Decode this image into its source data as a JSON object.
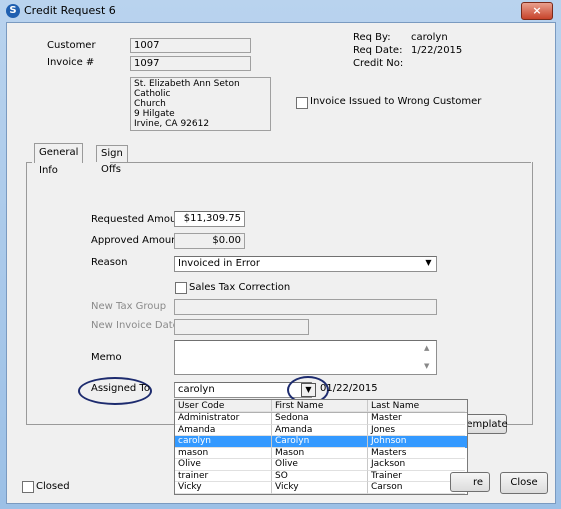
{
  "window": {
    "title": "Credit Request 6",
    "icon_label": "S",
    "close_label": "×"
  },
  "header": {
    "customer_label": "Customer",
    "customer_value": "1007",
    "invoice_label": "Invoice #",
    "invoice_value": "1097",
    "address_lines": [
      "St. Elizabeth Ann Seton Catholic",
      "Church",
      "9 Hilgate",
      "Irvine, CA  92612"
    ],
    "req_by_label": "Req By:",
    "req_by_value": "carolyn",
    "req_date_label": "Req Date:",
    "req_date_value": "1/22/2015",
    "credit_no_label": "Credit No:",
    "credit_no_value": "",
    "wrong_customer_label": "Invoice Issued to Wrong Customer",
    "wrong_customer_checked": false
  },
  "tabs": [
    {
      "label": "General Info",
      "active": true
    },
    {
      "label": "Sign Offs",
      "active": false
    }
  ],
  "general": {
    "requested_amount_label": "Requested Amount",
    "requested_amount_value": "$11,309.75",
    "approved_amount_label": "Approved Amount",
    "approved_amount_value": "$0.00",
    "reason_label": "Reason",
    "reason_value": "Invoiced in Error",
    "sales_tax_label": "Sales Tax Correction",
    "sales_tax_checked": false,
    "new_tax_group_label": "New Tax Group",
    "new_tax_group_value": "",
    "new_invoice_date_label": "New Invoice Date",
    "new_invoice_date_value": "",
    "memo_label": "Memo",
    "memo_value": "",
    "assigned_to_label": "Assigned To",
    "assigned_to_value": "carolyn",
    "assigned_date_value": "01/22/2015",
    "template_button_label": "Template"
  },
  "assigned_dropdown": {
    "columns": [
      "User Code",
      "First Name",
      "Last Name"
    ],
    "rows": [
      [
        "Administrator",
        "Sedona",
        "Master"
      ],
      [
        "Amanda",
        "Amanda",
        "Jones"
      ],
      [
        "carolyn",
        "Carolyn",
        "Johnson"
      ],
      [
        "mason",
        "Mason",
        "Masters"
      ],
      [
        "Olive",
        "Olive",
        "Jackson"
      ],
      [
        "trainer",
        "SO",
        "Trainer"
      ],
      [
        "Vicky",
        "Vicky",
        "Carson"
      ]
    ],
    "selected_index": 2
  },
  "footer": {
    "closed_label": "Closed",
    "closed_checked": false,
    "save_button_label": "re",
    "close_button_label": "Close"
  }
}
